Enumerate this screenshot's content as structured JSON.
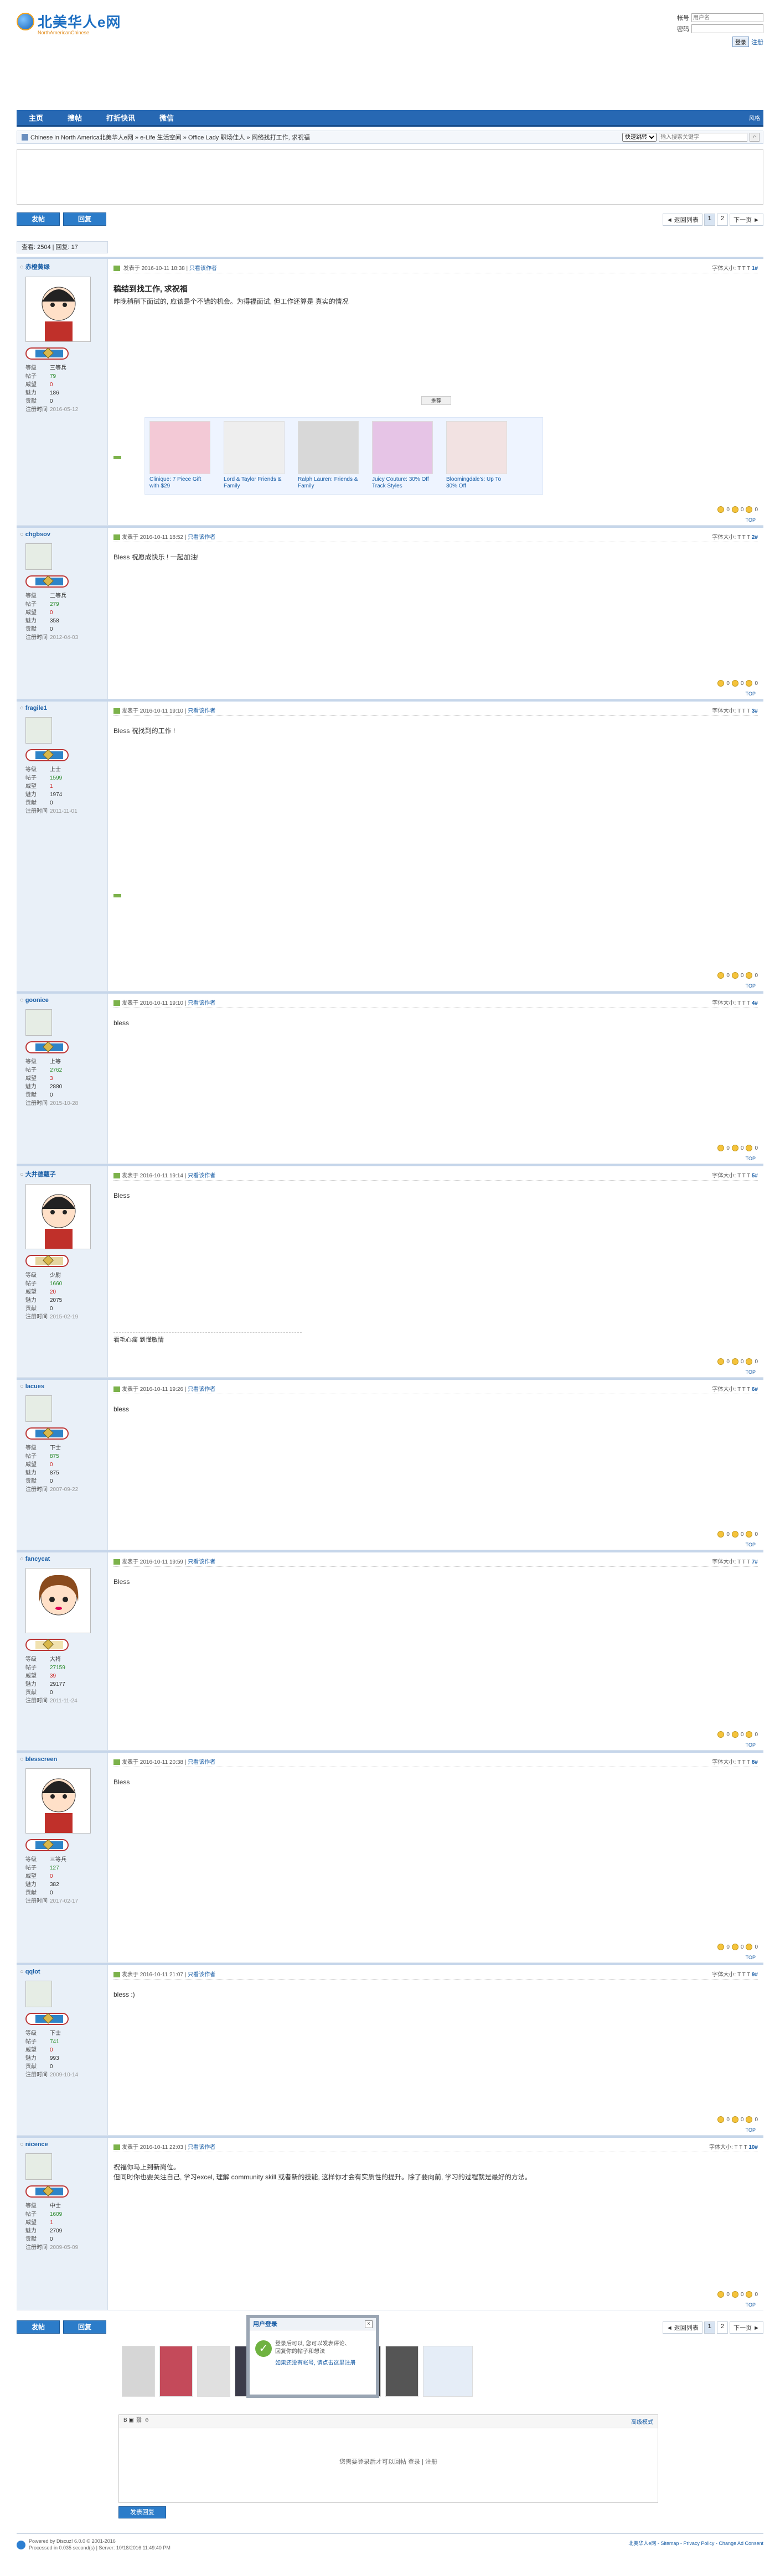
{
  "site": {
    "logo_text": "北美华人e网",
    "logo_sub": "NorthAmericanChinese"
  },
  "login": {
    "username_label": "帐号",
    "username_placeholder": "用户名",
    "password_label": "密码",
    "login_button": "登录",
    "register_link": "注册"
  },
  "nav": {
    "items": [
      "主页",
      "搜帖",
      "打折快讯",
      "微信"
    ],
    "right_text": "风格"
  },
  "breadcrumb": {
    "text": "Chinese in North America北美华人e网 » e-Life 生活空间 » Office Lady 职场佳人 » 网络找打工作, 求祝福",
    "quick_jump": "快速跳转",
    "search_placeholder": "输入搜索关键字"
  },
  "actions": {
    "post": "发帖",
    "reply": "回复"
  },
  "pager": {
    "back": "◄ 返回列表",
    "pages": [
      "1",
      "2"
    ],
    "next": "下一页 ►"
  },
  "stats": {
    "text": "查看: 2504 | 回复: 17"
  },
  "labels": {
    "grade": "等级",
    "posts": "帖子",
    "reputation": "威望",
    "charm": "魅力",
    "contrib": "贡献",
    "reg": "注册时间",
    "posted_at": "发表于",
    "view_author": "只看该作者",
    "font_size": "字体大小:",
    "top": "TOP",
    "support": "0",
    "oppose": "0",
    "neutral": "0",
    "mood_label": "心情"
  },
  "post1": {
    "floor": "1#",
    "user": "赤橙黄绿",
    "grade": "三等兵",
    "posts": "79",
    "reputation": "0",
    "charm": "186",
    "contrib": "0",
    "reg": "2016-05-12",
    "time": "2016-10-11 18:38",
    "title": "稿结到找工作, 求祝福",
    "body": "昨晚稍稍下面试的, 应该是个不错的机会。为得福面试, 但工作还算是 真实的情况",
    "ad_label": "推荐",
    "ads": [
      "Clinique: 7 Piece Gift with $29",
      "Lord & Taylor Friends & Family",
      "Ralph Lauren: Friends & Family",
      "Juicy Couture: 30% Off Track Styles",
      "Bloomingdale's: Up To 30% Off"
    ]
  },
  "post2": {
    "floor": "2#",
    "user": "chgbsov",
    "grade": "二等兵",
    "posts": "279",
    "reputation": "0",
    "charm": "358",
    "contrib": "0",
    "reg": "2012-04-03",
    "time": "2016-10-11 18:52",
    "body": "Bless 祝愿成快乐 !  一起加油!"
  },
  "post3": {
    "floor": "3#",
    "user": "fragile1",
    "grade": "上士",
    "posts": "1599",
    "reputation": "1",
    "charm": "1974",
    "contrib": "0",
    "reg": "2011-11-01",
    "time": "2016-10-11 19:10",
    "body": "Bless 祝找到的工作 !"
  },
  "post4": {
    "floor": "4#",
    "user": "goonice",
    "grade": "上等",
    "posts": "2762",
    "reputation": "3",
    "charm": "2880",
    "contrib": "0",
    "reg": "2015-10-28",
    "time": "2016-10-11 19:10",
    "body": "bless"
  },
  "post5": {
    "floor": "5#",
    "user": "大井德蘿子",
    "grade": "少尉",
    "posts": "1660",
    "reputation": "20",
    "charm": "2075",
    "contrib": "0",
    "reg": "2015-02-19",
    "time": "2016-10-11 19:14",
    "body": "Bless",
    "sig": "看毛心痛 到懂敏情"
  },
  "post6": {
    "floor": "6#",
    "user": "lacues",
    "grade": "下士",
    "posts": "875",
    "reputation": "0",
    "charm": "875",
    "contrib": "0",
    "reg": "2007-09-22",
    "time": "2016-10-11 19:26",
    "body": "bless"
  },
  "post7": {
    "floor": "7#",
    "user": "fancycat",
    "grade": "大将",
    "posts": "27159",
    "reputation": "39",
    "charm": "29177",
    "contrib": "0",
    "reg": "2011-11-24",
    "time": "2016-10-11 19:59",
    "body": "Bless"
  },
  "post8": {
    "floor": "8#",
    "user": "blesscreen",
    "grade": "三等兵",
    "posts": "127",
    "reputation": "0",
    "charm": "382",
    "contrib": "0",
    "reg": "2017-02-17",
    "time": "2016-10-11 20:38",
    "body": "Bless"
  },
  "post9": {
    "floor": "9#",
    "user": "qqlot",
    "grade": "下士",
    "posts": "741",
    "reputation": "0",
    "charm": "993",
    "contrib": "0",
    "reg": "2009-10-14",
    "time": "2016-10-11 21:07",
    "body": "bless :)"
  },
  "post10": {
    "floor": "10#",
    "user": "nicence",
    "grade": "中士",
    "posts": "1609",
    "reputation": "1",
    "charm": "2709",
    "contrib": "0",
    "reg": "2009-05-09",
    "time": "2016-10-11 22:03",
    "body1": "祝福你马上到新岗位。",
    "body2": "但同时你也要关注自己, 学习excel, 理解 community skill 或者新的技能, 这样你才会有实质性的提升。除了要向前, 学习的过程就是最好的方法。"
  },
  "popup": {
    "title": "用户登录",
    "msg1": "登录后可以, 您可以发表评论、",
    "msg2": "回复你的帖子和想法",
    "link": "如果还没有帐号, 请点击这里注册"
  },
  "editor": {
    "adv": "高级模式",
    "note": "您需要登录后才可以回帖  登录 | 注册",
    "send": "发表回复"
  },
  "footer": {
    "l1": "Powered by Discuz! 6.0.0 © 2001-2016",
    "l2": "Processed in 0.035 second(s) | Server: 10/18/2016 11:49:40 PM",
    "right": "北美华人e网 - Sitemap - Privacy Policy - Change Ad Consent"
  }
}
